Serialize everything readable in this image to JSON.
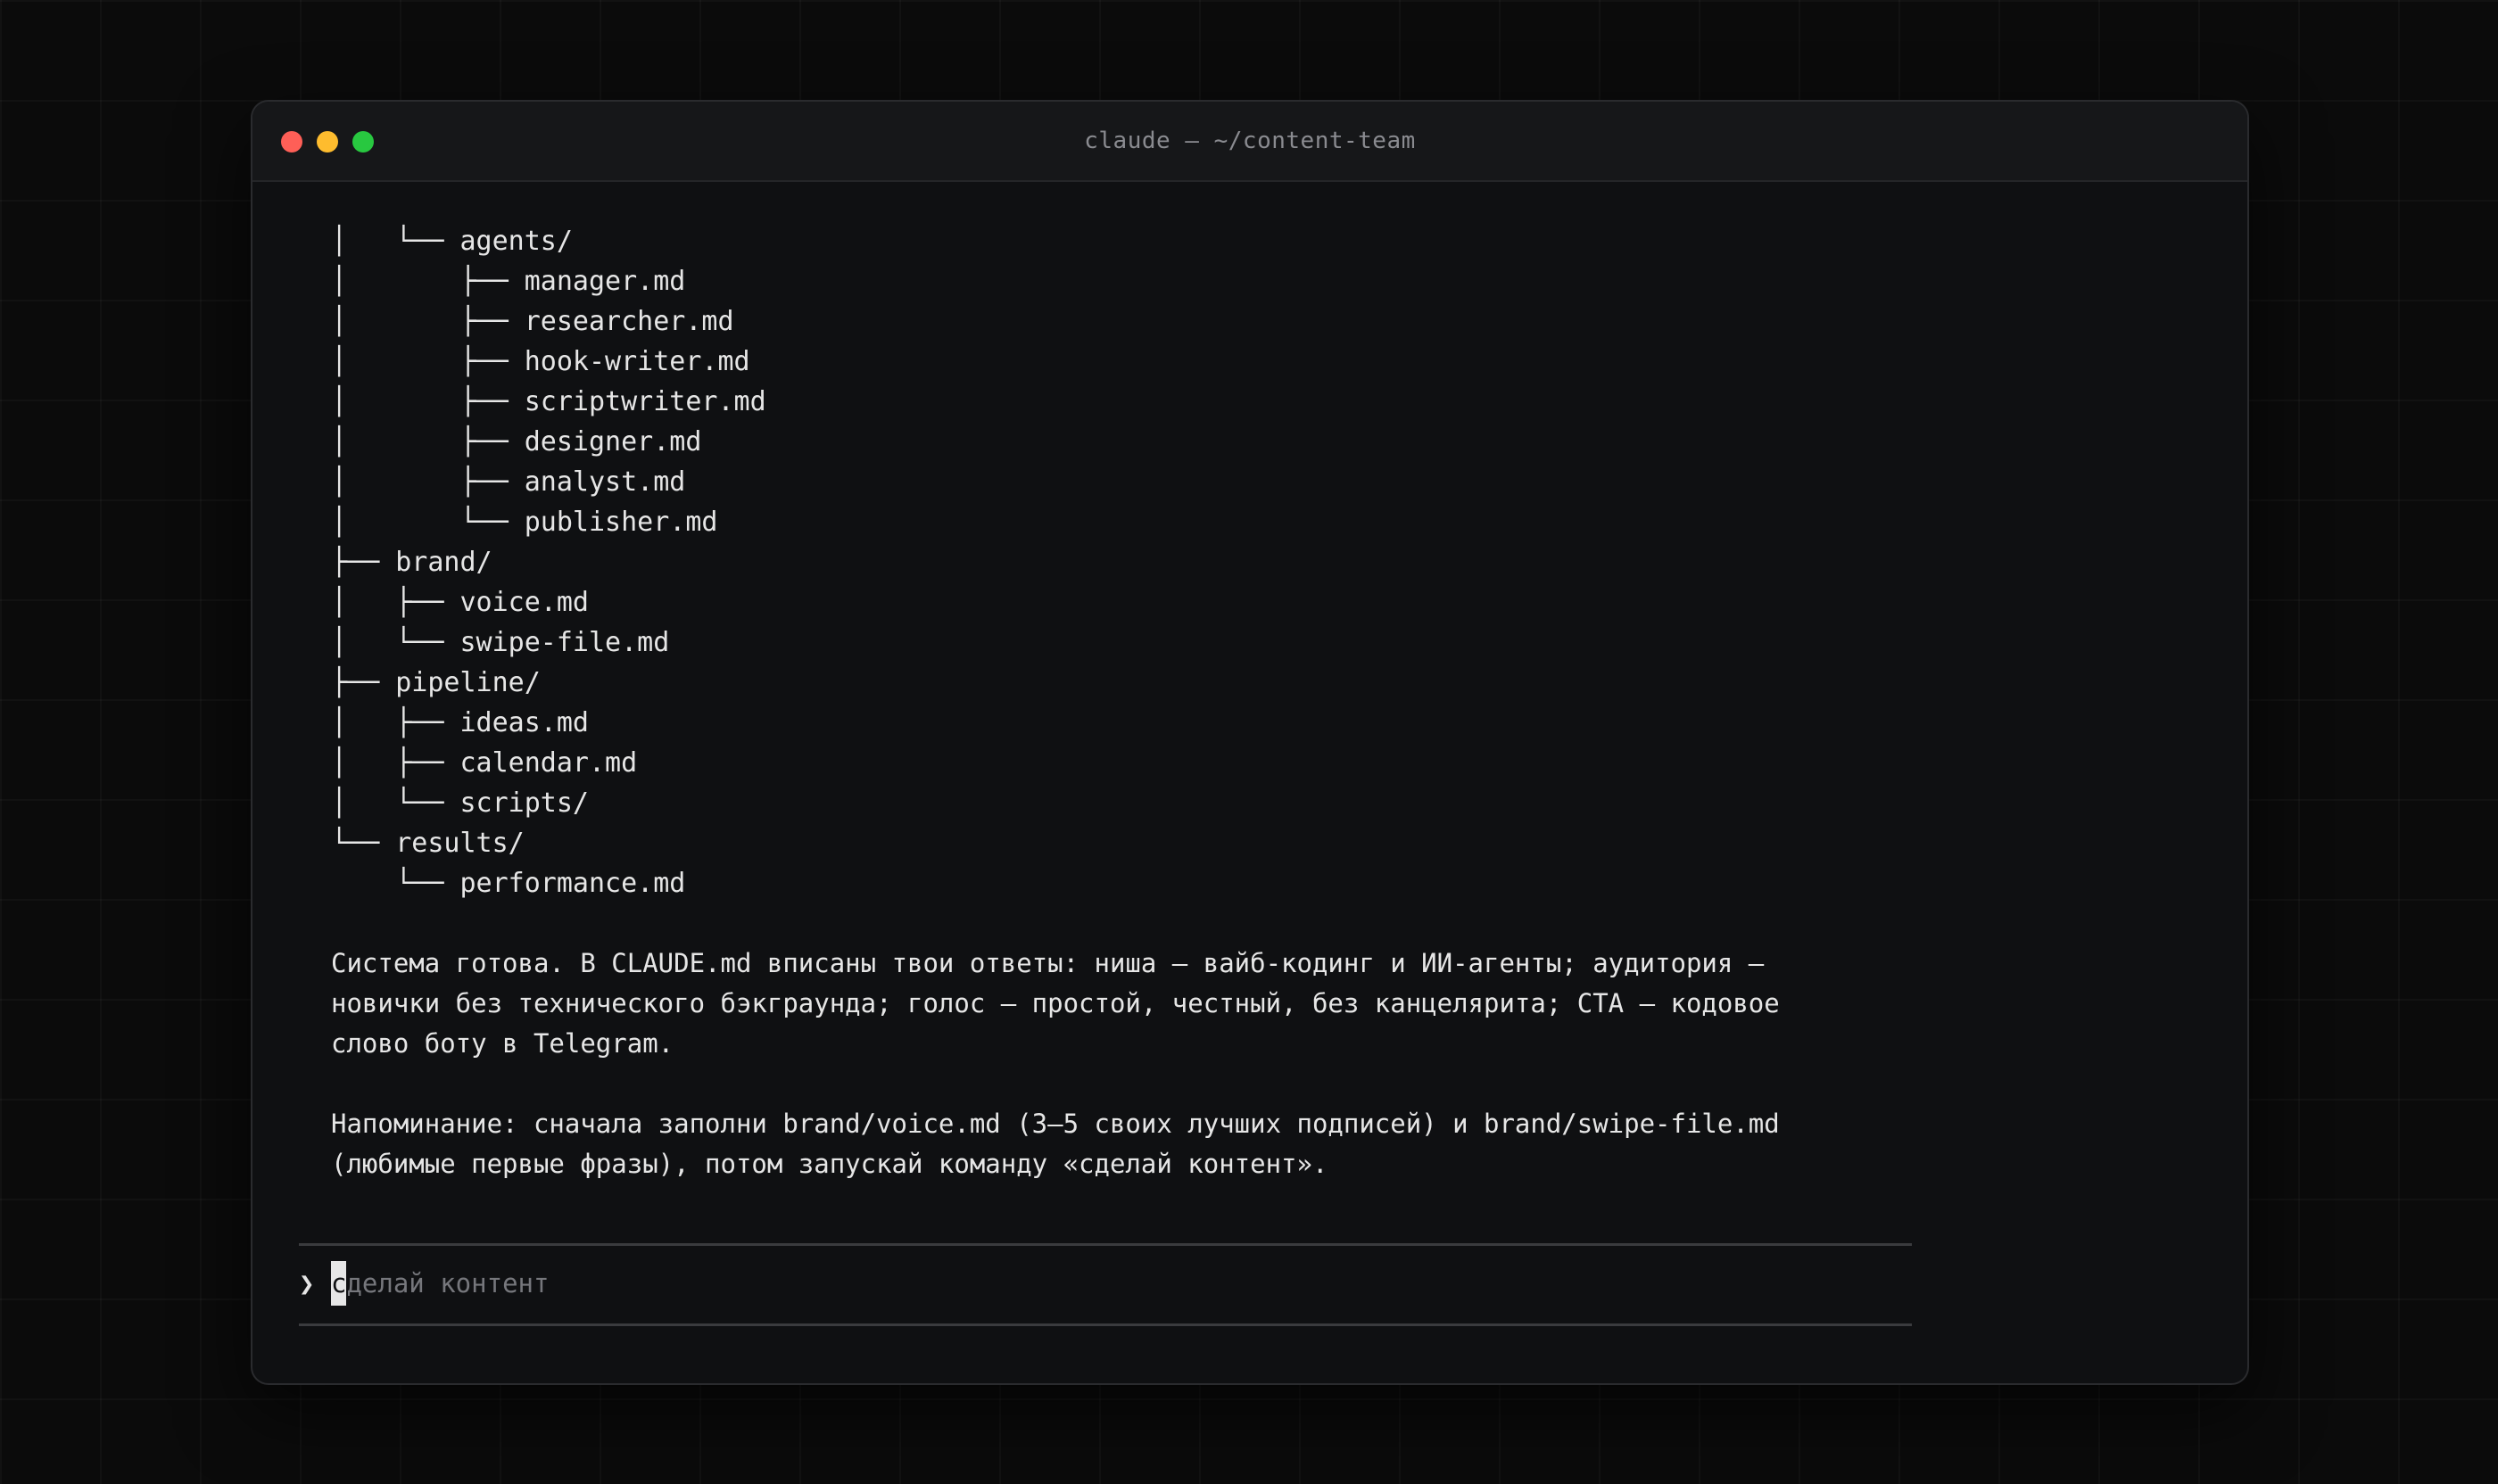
{
  "window": {
    "title": "claude — ~/content-team"
  },
  "tree": [
    "│   └── agents/",
    "│       ├── manager.md",
    "│       ├── researcher.md",
    "│       ├── hook-writer.md",
    "│       ├── scriptwriter.md",
    "│       ├── designer.md",
    "│       ├── analyst.md",
    "│       └── publisher.md",
    "├── brand/",
    "│   ├── voice.md",
    "│   └── swipe-file.md",
    "├── pipeline/",
    "│   ├── ideas.md",
    "│   ├── calendar.md",
    "│   └── scripts/",
    "└── results/",
    "    └── performance.md"
  ],
  "messages": {
    "system_ready": "Система готова. В CLAUDE.md вписаны твои ответы: ниша — вайб-кодинг и ИИ-агенты; аудитория — новички без технического бэкграунда; голос — простой, честный, без канцелярита; CTA — кодовое слово боту в Telegram.",
    "reminder": "Напоминание: сначала заполни brand/voice.md (3–5 своих лучших подписей) и brand/swipe-file.md (любимые первые фразы), потом запускай команду «сделай контент»."
  },
  "prompt": {
    "symbol": "❯",
    "cursor_char": "с",
    "placeholder_rest": "делай контент"
  },
  "colors": {
    "background": "#0b0b0b",
    "window": "#0f1012",
    "text": "#e6e6e6",
    "muted": "#76777c",
    "close": "#fe5f57",
    "minimize": "#febc2e",
    "maximize": "#28c840"
  }
}
